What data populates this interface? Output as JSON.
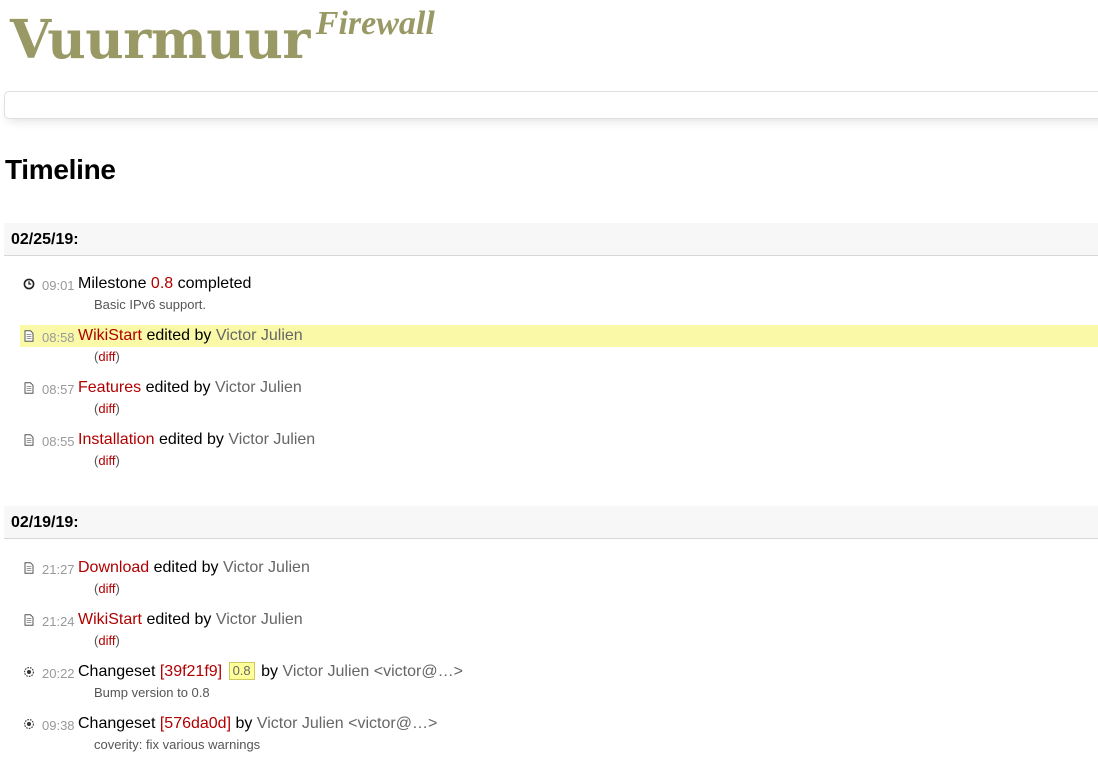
{
  "logo": {
    "main": "Vuurmuur",
    "sub": "Firewall"
  },
  "page_title": "Timeline",
  "days": [
    {
      "date": "02/25/19:",
      "events": [
        {
          "icon": "milestone-icon",
          "time": "09:01",
          "pre": "Milestone ",
          "link": "0.8",
          "mid": " completed",
          "author": "",
          "desc_text": "Basic IPv6 support."
        },
        {
          "icon": "wiki-page-icon",
          "time": "08:58",
          "pre": "",
          "link": "WikiStart",
          "mid": " edited by ",
          "author": "Victor Julien",
          "desc_open": "(",
          "desc_link": "diff",
          "desc_close": ")"
        },
        {
          "icon": "wiki-page-icon",
          "time": "08:57",
          "pre": "",
          "link": "Features",
          "mid": " edited by ",
          "author": "Victor Julien",
          "desc_open": "(",
          "desc_link": "diff",
          "desc_close": ")"
        },
        {
          "icon": "wiki-page-icon",
          "time": "08:55",
          "pre": "",
          "link": "Installation",
          "mid": " edited by ",
          "author": "Victor Julien",
          "desc_open": "(",
          "desc_link": "diff",
          "desc_close": ")"
        }
      ]
    },
    {
      "date": "02/19/19:",
      "events": [
        {
          "icon": "wiki-page-icon",
          "time": "21:27",
          "pre": "",
          "link": "Download",
          "mid": " edited by ",
          "author": "Victor Julien",
          "desc_open": "(",
          "desc_link": "diff",
          "desc_close": ")"
        },
        {
          "icon": "wiki-page-icon",
          "time": "21:24",
          "pre": "",
          "link": "WikiStart",
          "mid": " edited by ",
          "author": "Victor Julien",
          "desc_open": "(",
          "desc_link": "diff",
          "desc_close": ")"
        },
        {
          "icon": "changeset-icon",
          "time": "20:22",
          "pre": "Changeset ",
          "link": "[39f21f9]",
          "badge": "0.8",
          "mid": " by ",
          "author": "Victor Julien <victor@…>",
          "desc_text": "Bump version to 0.8"
        },
        {
          "icon": "changeset-icon",
          "time": "09:38",
          "pre": "Changeset ",
          "link": "[576da0d]",
          "mid": " by ",
          "author": "Victor Julien <victor@…>",
          "desc_text": "coverity: fix various warnings"
        }
      ]
    }
  ]
}
